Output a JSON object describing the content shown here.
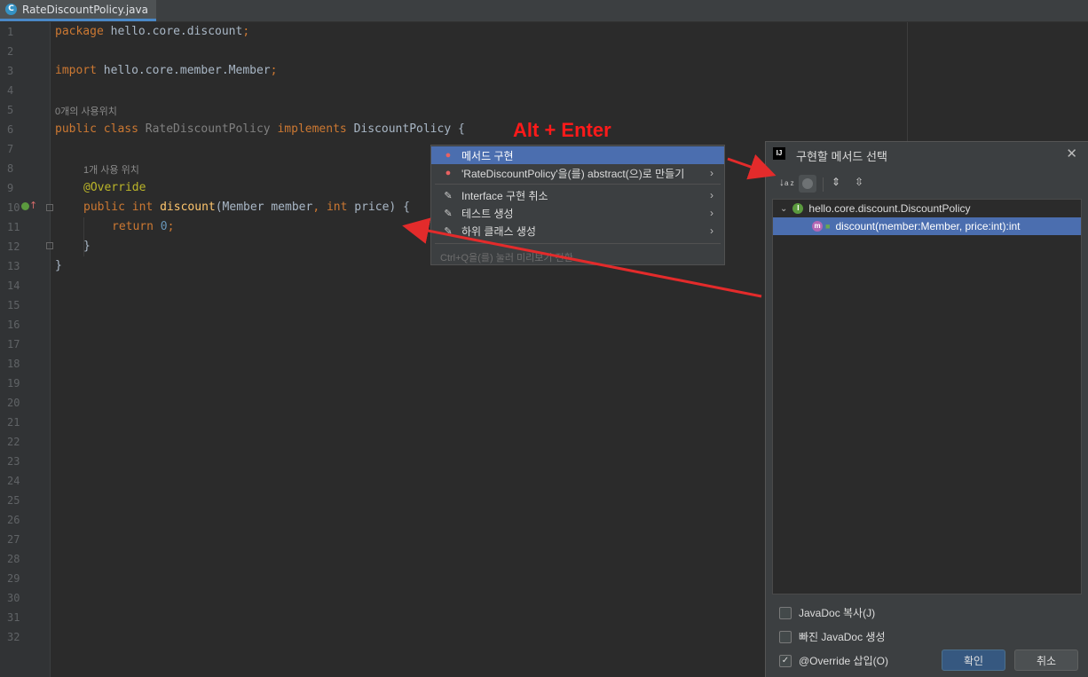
{
  "tab": {
    "icon": "C",
    "filename": "RateDiscountPolicy.java"
  },
  "line_numbers": [
    "1",
    "2",
    "3",
    "4",
    "5",
    "6",
    "7",
    "8",
    "9",
    "10",
    "11",
    "12",
    "13",
    "14",
    "15",
    "16",
    "17",
    "18",
    "19",
    "20",
    "21",
    "22",
    "23",
    "24",
    "25",
    "26",
    "27",
    "28",
    "29",
    "30",
    "31",
    "32"
  ],
  "code": {
    "l1_kw": "package",
    "l1_rest": " hello.core.discount",
    "l1_semi": ";",
    "l3_kw": "import",
    "l3_rest": " hello.core.member.Member",
    "l3_semi": ";",
    "hint_class": "0개의 사용위치",
    "l5_kw1": "public class",
    "l5_name": " RateDiscountPolicy ",
    "l5_kw2": "implements",
    "l5_rest": " DiscountPolicy {",
    "hint_method": "1개 사용 위치",
    "l7_ann": "@Override",
    "l8_kw1": "public int",
    "l8_fn": " discount",
    "l8_p1": "(Member member",
    "l8_comma": ", ",
    "l8_kw2": "int",
    "l8_p2": " price) {",
    "l9_kw": "return",
    "l9_num": " 0",
    "l9_semi": ";",
    "l10": "}",
    "l11": "}"
  },
  "annotation": {
    "label": "Alt + Enter"
  },
  "popup": {
    "items": [
      {
        "label": "메서드 구현",
        "icon": "bulb-icon",
        "selected": true
      },
      {
        "label": "'RateDiscountPolicy'을(를) abstract(으)로 만들기",
        "icon": "bulb-icon",
        "arrow": "›"
      },
      {
        "label": "Interface 구현 취소",
        "icon": "pencil-icon",
        "arrow": "›"
      },
      {
        "label": "테스트 생성",
        "icon": "pencil-icon",
        "arrow": "›"
      },
      {
        "label": "하위 클래스 생성",
        "icon": "pencil-icon",
        "arrow": "›"
      }
    ],
    "footer": "Ctrl+Q을(를) 눌러 미리보기 전환"
  },
  "dialog": {
    "logo": "IJ",
    "title": "구현할 메서드 선택",
    "close": "✕",
    "tree": {
      "parent": "hello.core.discount.DiscountPolicy",
      "parent_badge": "I",
      "child": "discount(member:Member, price:int):int",
      "child_badge": "m"
    },
    "options": [
      {
        "label": "JavaDoc 복사(J)",
        "checked": false
      },
      {
        "label": "빠진 JavaDoc 생성",
        "checked": false
      },
      {
        "label": "@Override 삽입(O)",
        "checked": true
      }
    ],
    "ok_label": "확인",
    "cancel_label": "취소"
  },
  "colors": {
    "annotation_arrow": "#e32b2b",
    "selection": "#4b6eaf",
    "accent": "#4a88c7"
  }
}
